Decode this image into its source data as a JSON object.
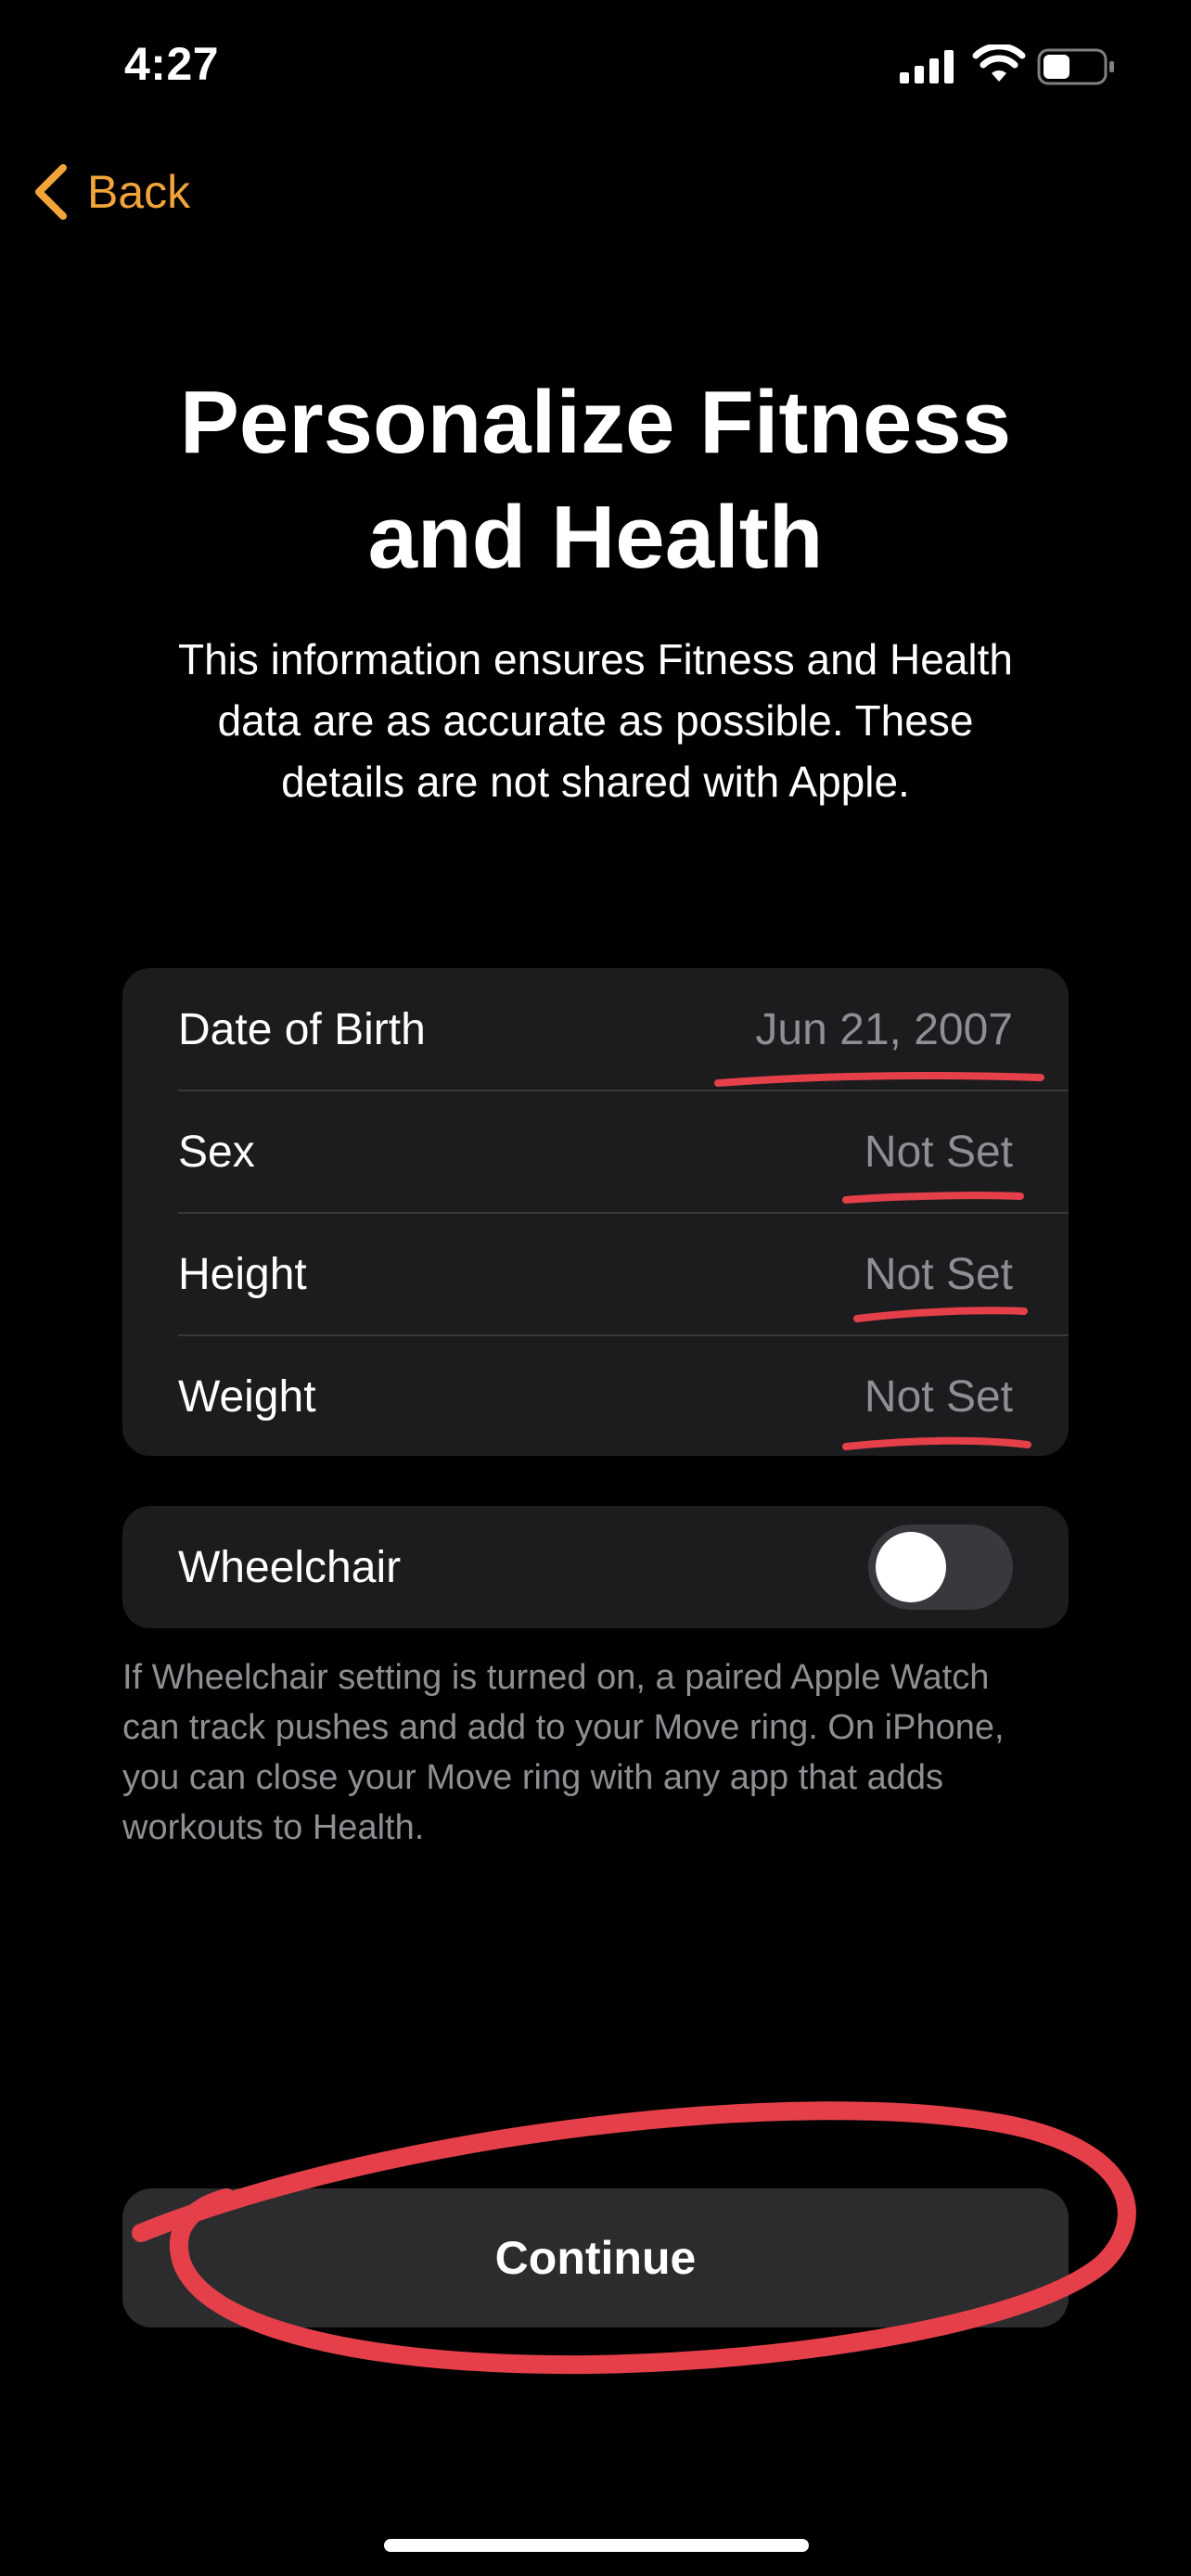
{
  "status_bar": {
    "time": "4:27",
    "battery_level": 0.45
  },
  "nav": {
    "back_label": "Back"
  },
  "header": {
    "title_line1": "Personalize Fitness",
    "title_line2": "and Health",
    "subtitle_line1": "This information ensures Fitness and Health",
    "subtitle_line2": "data are as accurate as possible. These",
    "subtitle_line3": "details are not shared with Apple."
  },
  "details": {
    "rows": [
      {
        "label": "Date of Birth",
        "value": "Jun 21, 2007"
      },
      {
        "label": "Sex",
        "value": "Not Set"
      },
      {
        "label": "Height",
        "value": "Not Set"
      },
      {
        "label": "Weight",
        "value": "Not Set"
      }
    ]
  },
  "wheelchair": {
    "label": "Wheelchair",
    "enabled": false
  },
  "footnote": {
    "line1": "If Wheelchair setting is turned on, a paired Apple Watch",
    "line2": "can track pushes and add to your Move ring. On iPhone,",
    "line3": "you can close your Move ring with any app that adds",
    "line4": "workouts to Health."
  },
  "continue": {
    "label": "Continue"
  },
  "colors": {
    "accent": "#f2a33a",
    "annotation": "#e5404a",
    "card_background": "#1c1c1e",
    "secondary_text": "#8e8e93"
  },
  "icons": [
    "signal-icon",
    "wifi-icon",
    "battery-icon",
    "chevron-left-icon"
  ]
}
